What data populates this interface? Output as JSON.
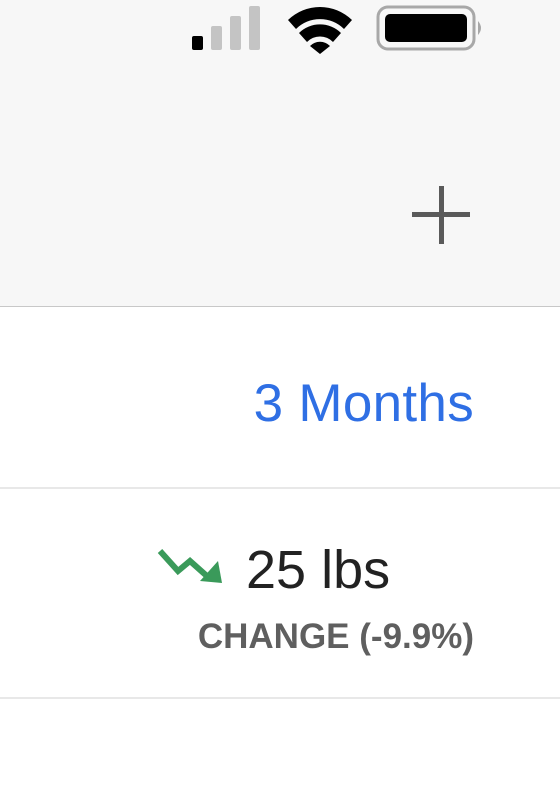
{
  "status_bar": {
    "signal_icon": "cellular-signal-icon",
    "signal_bars_active": 1,
    "signal_bars_total": 4,
    "wifi_icon": "wifi-icon",
    "battery_icon": "battery-icon",
    "battery_level": 0.95
  },
  "header": {
    "add_icon": "plus-icon",
    "background_color": "#f7f7f7"
  },
  "period": {
    "label": "3 Months",
    "color": "#2f6fe4"
  },
  "change": {
    "trend_icon": "trend-down-icon",
    "trend_color": "#3a9a5a",
    "value": "25 lbs",
    "label": "CHANGE (-9.9%)"
  }
}
